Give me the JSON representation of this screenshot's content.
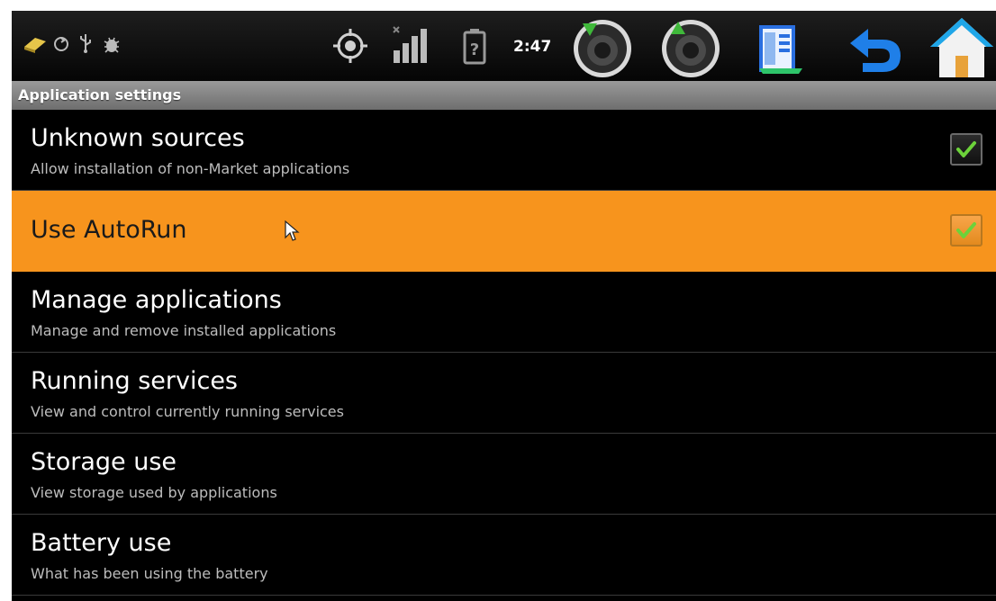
{
  "status_bar": {
    "time": "2:47",
    "notification_icons": [
      "mirror-icon",
      "sync-icon",
      "usb-icon",
      "debug-bug-icon"
    ],
    "status_icons": [
      "gps-icon",
      "signal-icon",
      "battery-unknown-icon"
    ],
    "soft_keys": [
      "volume-down-icon",
      "volume-up-icon",
      "menu-icon",
      "back-icon",
      "home-icon"
    ]
  },
  "section_header": "Application settings",
  "settings": [
    {
      "title": "Unknown sources",
      "subtitle": "Allow installation of non-Market applications",
      "checked": true
    },
    {
      "title": "Use AutoRun",
      "subtitle": "",
      "checked": true,
      "highlighted": true
    },
    {
      "title": "Manage applications",
      "subtitle": "Manage and remove installed applications"
    },
    {
      "title": "Running services",
      "subtitle": "View and control currently running services"
    },
    {
      "title": "Storage use",
      "subtitle": "View storage used by applications"
    },
    {
      "title": "Battery use",
      "subtitle": "What has been using the battery"
    }
  ],
  "colors": {
    "highlight": "#f7941d",
    "check": "#6cd23a",
    "background": "#000000",
    "header": "#8a8a8a"
  }
}
